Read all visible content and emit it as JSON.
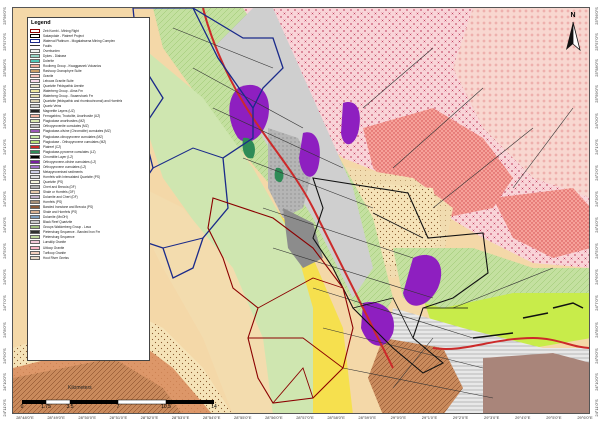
{
  "legend": {
    "title": "Legend",
    "items": [
      {
        "label": "Zeb Kombi - Mining Right",
        "color": "#8b0000",
        "kind": "box"
      },
      {
        "label": "Sakarpdale - Platreef Project",
        "color": "#000000",
        "kind": "box"
      },
      {
        "label": "Waterval Platinum - Mogalakwena Mining Complex",
        "color": "#1a2a8a",
        "kind": "box"
      },
      {
        "label": "Faults",
        "color": "#333333",
        "kind": "line"
      },
      {
        "label": "Overburden",
        "color": "#f2f2f2"
      },
      {
        "label": "Dykes - Diabase",
        "color": "#9ad7c8"
      },
      {
        "label": "Dolerite",
        "color": "#4fc9b9"
      },
      {
        "label": "Rooiberg Group - Kwaggasnek Volcanics",
        "color": "#f2b0a0"
      },
      {
        "label": "Rashoop Granophyre Suite",
        "color": "#c9a06a"
      },
      {
        "label": "Granite",
        "color": "#f7c9c2"
      },
      {
        "label": "Lebowa Granite Suite",
        "color": "#f8d9ea"
      },
      {
        "label": "Quartzite Feldspathic Arenite",
        "color": "#e8e0c8"
      },
      {
        "label": "Waterberg Group - Alma Fm",
        "color": "#ece6a0"
      },
      {
        "label": "Waterberg Group - Swaershoek Fm",
        "color": "#e4ddb2"
      },
      {
        "label": "Quartzite (feldspathic and rhombochromal) and Hornfels",
        "color": "#d8cfb0"
      },
      {
        "label": "Quartz Veins",
        "color": "#cccccc"
      },
      {
        "label": "Magnetite Layers (UZ)",
        "color": "#222222"
      },
      {
        "label": "Ferrogabbro, Troctolite, Anorthosite (UZ)",
        "color": "#f6b8a6"
      },
      {
        "label": "Plagioclase anorthosites (MZ)",
        "color": "#d9e8b0"
      },
      {
        "label": "Orthopyroxenite cumulates (MZ)",
        "color": "#bfbfbf"
      },
      {
        "label": "Plagioclase-olivine (Chromolite) cumulates (MZ)",
        "color": "#9b59b6"
      },
      {
        "label": "Plagioclase-clinopyroxene cumulates (MZ)",
        "color": "#c6e6a6"
      },
      {
        "label": "Plagioclase - Orthopyroxene cumulates (MZ)",
        "color": "#b8e07a"
      },
      {
        "label": "Platreef (CZ)",
        "color": "#cc2a2a"
      },
      {
        "label": "Plagioclase-pyroxene cumulates (LZ)",
        "color": "#2e8b57"
      },
      {
        "label": "Chromitite Layer (LZ)",
        "color": "#000000"
      },
      {
        "label": "Orthopyroxene-olivine cumulates (LZ)",
        "color": "#7a1fa2"
      },
      {
        "label": "Orthopyroxene cumulates (LZ)",
        "color": "#a070c8"
      },
      {
        "label": "Metapyroxenised sediments",
        "color": "#d0d0e8"
      },
      {
        "label": "Hornfels with Intercalated Quartzite (PS)",
        "color": "#e0e0e0"
      },
      {
        "label": "Quartzite (PS)",
        "color": "#f5f5dc"
      },
      {
        "label": "Chert and Breccia (DF)",
        "color": "#b0b0b0"
      },
      {
        "label": "Shale or Hornfels (DF)",
        "color": "#e6c8a8"
      },
      {
        "label": "Dolomite and Chert (DF)",
        "color": "#c0b0c8"
      },
      {
        "label": "Hornfels (PS)",
        "color": "#a89078"
      },
      {
        "label": "Banded Ironstone and Breccia (PS)",
        "color": "#8a5a3a"
      },
      {
        "label": "Shale and Hornfels (PS)",
        "color": "#d8b090"
      },
      {
        "label": "Dolomite (MnOH)",
        "color": "#7fa0c0"
      },
      {
        "label": "Black Reef Quartzite",
        "color": "#c8c8c8"
      },
      {
        "label": "Groups Wakkerberg Group - Lava",
        "color": "#a0c080"
      },
      {
        "label": "Pietersburg Sequence - Banded Iron Fm",
        "color": "#303030"
      },
      {
        "label": "Pietersburg Sequence",
        "color": "#c0d8a0"
      },
      {
        "label": "Lunsklip Granite",
        "color": "#f0c8d8"
      },
      {
        "label": "Uitloop Granite",
        "color": "#f8b8c8"
      },
      {
        "label": "Turfloop Granite",
        "color": "#f4d0c0"
      },
      {
        "label": "Hout River Gneiss",
        "color": "#e8d8c8"
      }
    ]
  },
  "north": {
    "label": "N"
  },
  "scale": {
    "labels": [
      "0",
      "1.75",
      "3.5",
      "7",
      "10.5",
      "14"
    ],
    "unit": "Kilometers"
  },
  "ticks": {
    "bottom": [
      "28°48'0\"E",
      "28°49'0\"E",
      "28°50'0\"E",
      "28°51'0\"E",
      "28°52'0\"E",
      "28°53'0\"E",
      "28°54'0\"E",
      "28°55'0\"E",
      "28°56'0\"E",
      "28°57'0\"E",
      "28°58'0\"E",
      "28°59'0\"E",
      "29°0'0\"E",
      "29°1'0\"E",
      "29°2'0\"E",
      "29°3'0\"E",
      "29°4'0\"E",
      "29°5'0\"E",
      "29°6'0\"E"
    ],
    "left": [
      "23°56'0\"S",
      "23°57'0\"S",
      "23°58'0\"S",
      "23°59'0\"S",
      "24°0'0\"S",
      "24°1'0\"S",
      "24°2'0\"S",
      "24°3'0\"S",
      "24°4'0\"S",
      "24°5'0\"S",
      "24°6'0\"S",
      "24°7'0\"S",
      "24°8'0\"S",
      "24°9'0\"S",
      "24°10'0\"S",
      "24°11'0\"S"
    ]
  },
  "colors": {
    "waterberg": "#f5e3b8",
    "granite_pink": "#f6b7b0",
    "granite_light": "#f9d4d8",
    "mz_green": "#b9d98a",
    "yellow_band": "#f6e04e",
    "sand": "#f1d6a0",
    "brown": "#c08060",
    "purple": "#8e1fc0",
    "red_zeb": "#8b0000",
    "blue_waterval": "#1a2a8a",
    "lime": "#c6ee3a"
  }
}
